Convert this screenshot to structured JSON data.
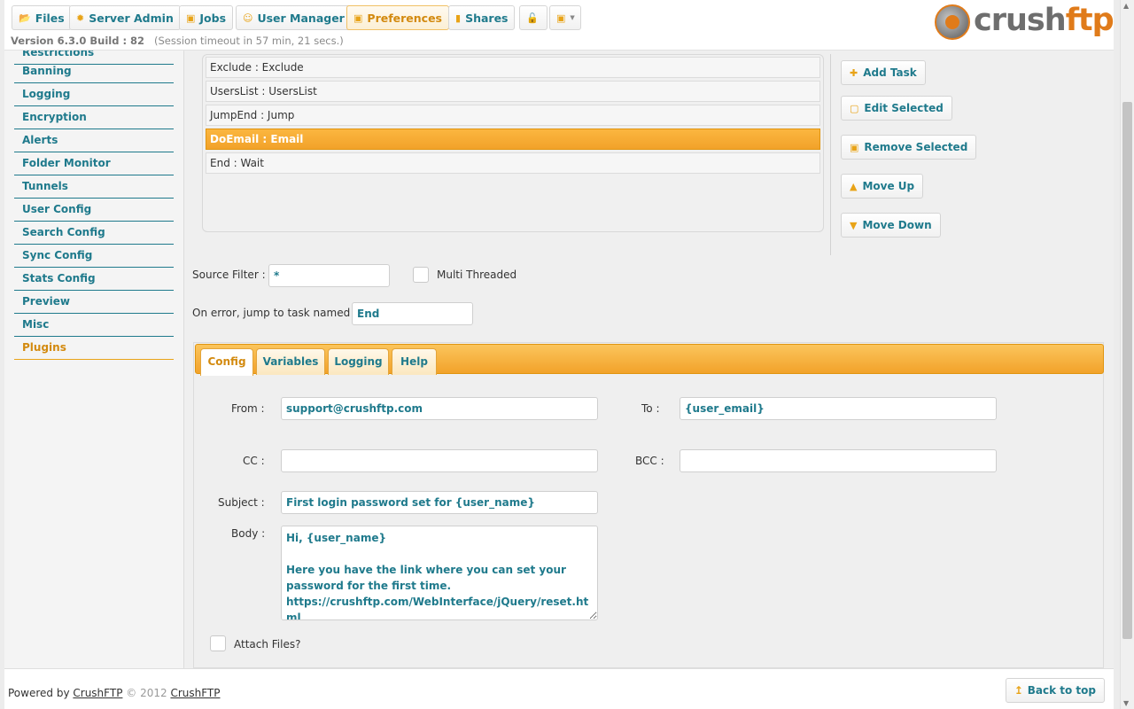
{
  "nav": {
    "items": [
      {
        "label": "Files",
        "icon": "folder-icon"
      },
      {
        "label": "Server Admin",
        "icon": "gear-icon"
      },
      {
        "label": "Jobs",
        "icon": "jobs-icon"
      },
      {
        "label": "User Manager",
        "icon": "user-icon"
      },
      {
        "label": "Preferences",
        "icon": "preferences-icon",
        "active": true
      },
      {
        "label": "Shares",
        "icon": "shares-icon"
      },
      {
        "label": "",
        "icon": "unlock-icon"
      },
      {
        "label": "",
        "icon": "image-dropdown-icon"
      }
    ],
    "version": "Version 6.3.0 Build : 82",
    "session": "(Session timeout in 57 min, 21 secs.)",
    "logo": "crushftp"
  },
  "sidebar": {
    "items": [
      {
        "label": "Restrictions"
      },
      {
        "label": "Banning"
      },
      {
        "label": "Logging"
      },
      {
        "label": "Encryption"
      },
      {
        "label": "Alerts"
      },
      {
        "label": "Folder Monitor"
      },
      {
        "label": "Tunnels"
      },
      {
        "label": "User Config"
      },
      {
        "label": "Search Config"
      },
      {
        "label": "Sync Config"
      },
      {
        "label": "Stats Config"
      },
      {
        "label": "Preview"
      },
      {
        "label": "Misc"
      },
      {
        "label": "Plugins",
        "active": true
      }
    ]
  },
  "tasks": [
    {
      "label": "Exclude : Exclude"
    },
    {
      "label": "UsersList : UsersList"
    },
    {
      "label": "JumpEnd : Jump"
    },
    {
      "label": "DoEmail : Email",
      "selected": true
    },
    {
      "label": "End : Wait"
    }
  ],
  "actions": {
    "add": "Add Task",
    "edit": "Edit Selected",
    "remove": "Remove Selected",
    "up": "Move Up",
    "down": "Move Down"
  },
  "form": {
    "source_filter_label": "Source Filter :",
    "source_filter_value": "*",
    "multi_threaded_label": "Multi Threaded",
    "on_error_label": "On error, jump to task named :",
    "on_error_value": "End"
  },
  "tabs": [
    {
      "label": "Config",
      "active": true
    },
    {
      "label": "Variables"
    },
    {
      "label": "Logging"
    },
    {
      "label": "Help"
    }
  ],
  "email": {
    "from_label": "From :",
    "from_value": "support@crushftp.com",
    "to_label": "To :",
    "to_value": "{user_email}",
    "cc_label": "CC :",
    "cc_value": "",
    "bcc_label": "BCC :",
    "bcc_value": "",
    "subject_label": "Subject :",
    "subject_value": "First login password set for {user_name}",
    "body_label": "Body :",
    "body_value": "Hi, {user_name}\n\nHere you have the link where you can set your password for the first time.\nhttps://crushftp.com/WebInterface/jQuery/reset.html",
    "attach_label": "Attach Files?"
  },
  "footer": {
    "powered_by": "Powered by",
    "link1": "CrushFTP",
    "copyright": "© 2012",
    "link2": "CrushFTP",
    "back_to_top": "Back to top"
  },
  "colors": {
    "accent": "#e8a317",
    "link": "#1f7a8c"
  }
}
